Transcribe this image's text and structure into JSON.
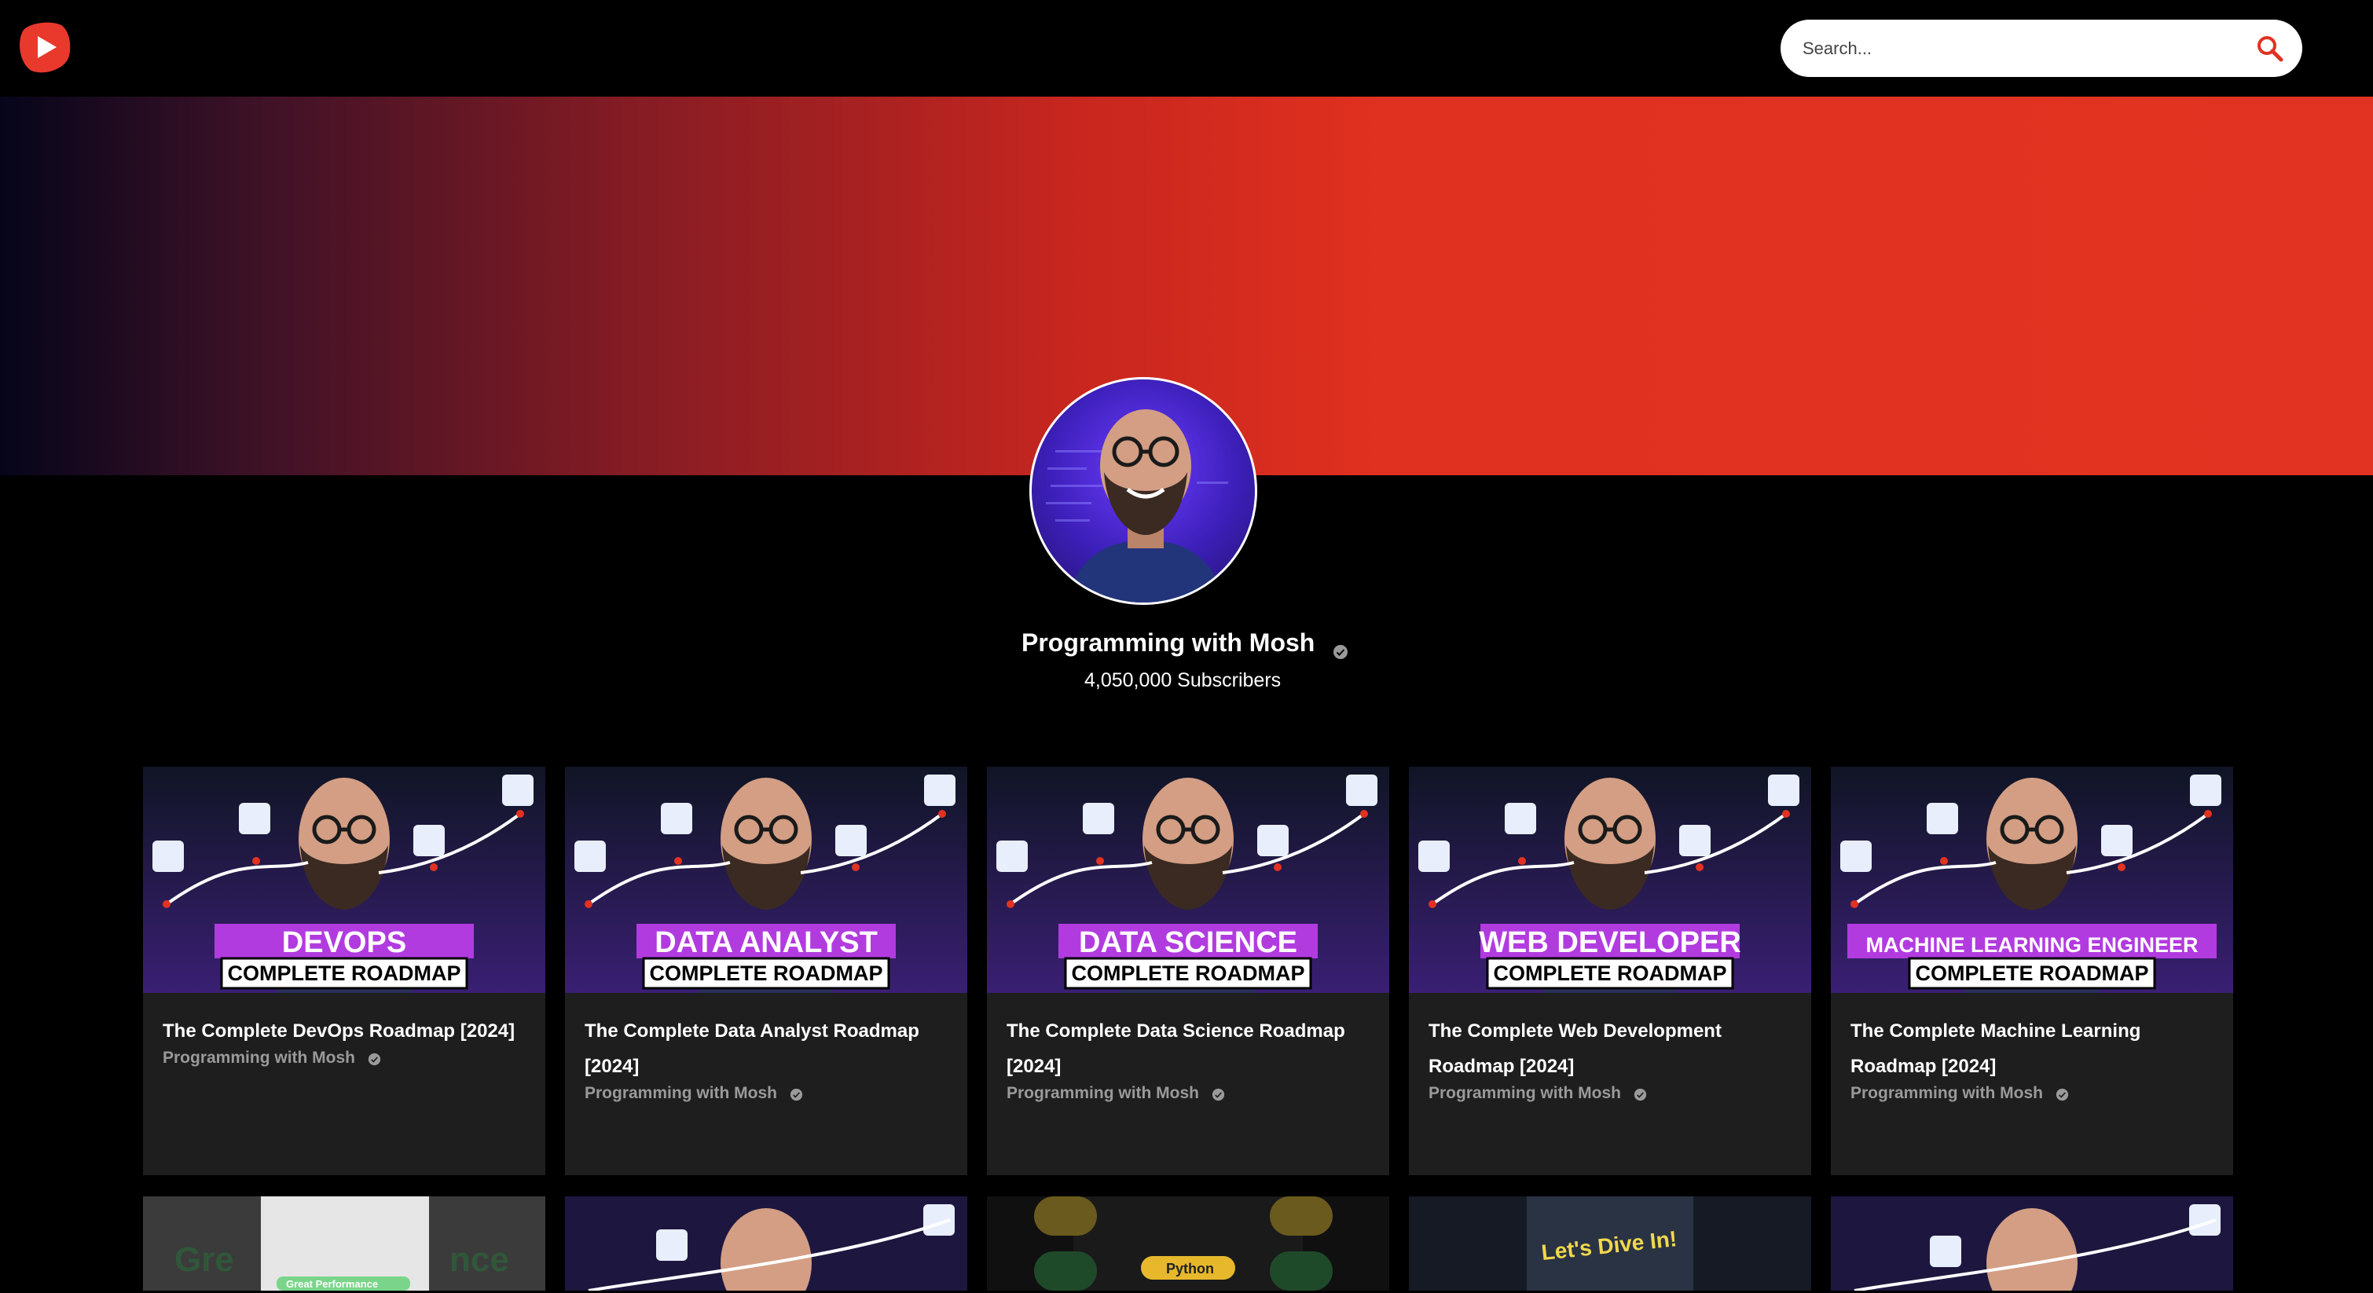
{
  "app": {
    "logo_icon": "youtube-play-logo-icon",
    "brand_color": "#e8392c"
  },
  "search": {
    "placeholder": "Search...",
    "icon": "search-icon",
    "icon_color": "#e23221"
  },
  "channel": {
    "name": "Programming with Mosh",
    "subscribers": "4,050,000 Subscribers",
    "verified_icon": "verified-check-icon"
  },
  "videos": [
    {
      "title": "The Complete DevOps Roadmap [2024]",
      "channel": "Programming with Mosh",
      "badge": "DEVOPS",
      "subtitle": "COMPLETE ROADMAP"
    },
    {
      "title": "The Complete Data Analyst Roadmap [2024]",
      "channel": "Programming with Mosh",
      "badge": "DATA ANALYST",
      "subtitle": "COMPLETE ROADMAP"
    },
    {
      "title": "The Complete Data Science Roadmap [2024]",
      "channel": "Programming with Mosh",
      "badge": "DATA SCIENCE",
      "subtitle": "COMPLETE ROADMAP"
    },
    {
      "title": "The Complete Web Development Roadmap [2024]",
      "channel": "Programming with Mosh",
      "badge": "WEB DEVELOPER",
      "subtitle": "COMPLETE ROADMAP"
    },
    {
      "title": "The Complete Machine Learning Roadmap [2024]",
      "channel": "Programming with Mosh",
      "badge": "MACHINE LEARNING ENGINEER",
      "subtitle": "COMPLETE ROADMAP"
    }
  ],
  "row2_thumbs": [
    {
      "text": "Great Performance"
    },
    {
      "text": ""
    },
    {
      "text": "Python"
    },
    {
      "text": "Let's Dive In!"
    },
    {
      "text": ""
    }
  ]
}
